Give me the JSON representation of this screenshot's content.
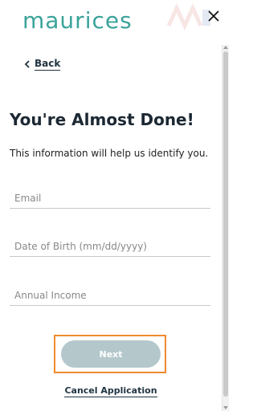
{
  "header": {
    "logo_text": "maurices",
    "close_icon": "close-icon",
    "brand_color": "#3aa39a"
  },
  "nav": {
    "back_label": "Back",
    "back_icon": "chevron-left-icon"
  },
  "main": {
    "title": "You're Almost Done!",
    "subtitle": "This information will help us identify you."
  },
  "form": {
    "email_placeholder": "Email",
    "email_value": "",
    "dob_placeholder": "Date of Birth (mm/dd/yyyy)",
    "dob_value": "",
    "income_placeholder": "Annual Income",
    "income_value": ""
  },
  "actions": {
    "next_label": "Next",
    "cancel_label": "Cancel Application",
    "highlight_color": "#f08a2c",
    "next_button_color": "#b4c8cc"
  }
}
